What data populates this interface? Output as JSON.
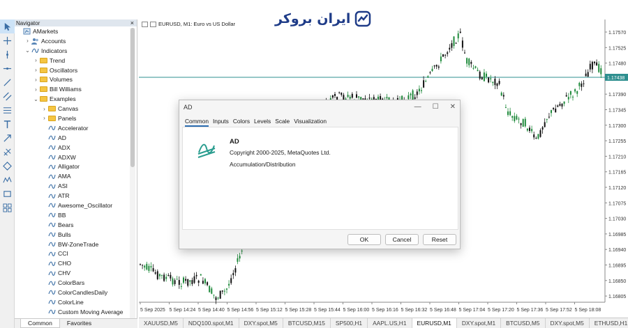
{
  "toolbar": {
    "tools": [
      "cursor-icon",
      "crosshair-icon",
      "vertical-line-icon",
      "horizontal-line-icon",
      "trendline-icon",
      "channel-icon",
      "fibonacci-icon",
      "text-icon",
      "arrow-icon",
      "pitchfork-icon",
      "shape-icon",
      "elliott-icon",
      "rectangle-icon",
      "objects-icon"
    ]
  },
  "navigator": {
    "title": "Navigator",
    "close": "×",
    "tree": [
      {
        "label": "AMarkets",
        "level": 0,
        "chev": "",
        "icon": "broker"
      },
      {
        "label": "Accounts",
        "level": 1,
        "chev": "›",
        "icon": "accounts"
      },
      {
        "label": "Indicators",
        "level": 1,
        "chev": "⌄",
        "icon": "indicator"
      },
      {
        "label": "Trend",
        "level": 2,
        "chev": "›",
        "icon": "folder"
      },
      {
        "label": "Oscillators",
        "level": 2,
        "chev": "›",
        "icon": "folder"
      },
      {
        "label": "Volumes",
        "level": 2,
        "chev": "›",
        "icon": "folder"
      },
      {
        "label": "Bill Williams",
        "level": 2,
        "chev": "›",
        "icon": "folder"
      },
      {
        "label": "Examples",
        "level": 2,
        "chev": "⌄",
        "icon": "folder"
      },
      {
        "label": "Canvas",
        "level": 3,
        "chev": "›",
        "icon": "folder"
      },
      {
        "label": "Panels",
        "level": 3,
        "chev": "›",
        "icon": "folder"
      },
      {
        "label": "Accelerator",
        "level": 3,
        "chev": "",
        "icon": "indicator"
      },
      {
        "label": "AD",
        "level": 3,
        "chev": "",
        "icon": "indicator"
      },
      {
        "label": "ADX",
        "level": 3,
        "chev": "",
        "icon": "indicator"
      },
      {
        "label": "ADXW",
        "level": 3,
        "chev": "",
        "icon": "indicator"
      },
      {
        "label": "Alligator",
        "level": 3,
        "chev": "",
        "icon": "indicator"
      },
      {
        "label": "AMA",
        "level": 3,
        "chev": "",
        "icon": "indicator"
      },
      {
        "label": "ASI",
        "level": 3,
        "chev": "",
        "icon": "indicator"
      },
      {
        "label": "ATR",
        "level": 3,
        "chev": "",
        "icon": "indicator"
      },
      {
        "label": "Awesome_Oscillator",
        "level": 3,
        "chev": "",
        "icon": "indicator"
      },
      {
        "label": "BB",
        "level": 3,
        "chev": "",
        "icon": "indicator"
      },
      {
        "label": "Bears",
        "level": 3,
        "chev": "",
        "icon": "indicator"
      },
      {
        "label": "Bulls",
        "level": 3,
        "chev": "",
        "icon": "indicator"
      },
      {
        "label": "BW-ZoneTrade",
        "level": 3,
        "chev": "",
        "icon": "indicator"
      },
      {
        "label": "CCI",
        "level": 3,
        "chev": "",
        "icon": "indicator"
      },
      {
        "label": "CHO",
        "level": 3,
        "chev": "",
        "icon": "indicator"
      },
      {
        "label": "CHV",
        "level": 3,
        "chev": "",
        "icon": "indicator"
      },
      {
        "label": "ColorBars",
        "level": 3,
        "chev": "",
        "icon": "indicator"
      },
      {
        "label": "ColorCandlesDaily",
        "level": 3,
        "chev": "",
        "icon": "indicator"
      },
      {
        "label": "ColorLine",
        "level": 3,
        "chev": "",
        "icon": "indicator"
      },
      {
        "label": "Custom Moving Average",
        "level": 3,
        "chev": "",
        "icon": "indicator"
      }
    ],
    "tabs": {
      "common": "Common",
      "favorites": "Favorites"
    }
  },
  "logo": {
    "text": "ایران بروکر"
  },
  "chart": {
    "title": "EURUSD, M1:  Euro vs US Dollar",
    "bid_line_value": "1.17438",
    "price_ticks": [
      "1.17570",
      "1.17525",
      "1.17480",
      "1.17438",
      "1.17390",
      "1.17345",
      "1.17300",
      "1.17255",
      "1.17210",
      "1.17165",
      "1.17120",
      "1.17075",
      "1.17030",
      "1.16985",
      "1.16940",
      "1.16895",
      "1.16850",
      "1.16805"
    ],
    "time_ticks": [
      "5 Sep 2025",
      "5 Sep 14:24",
      "5 Sep 14:40",
      "5 Sep 14:56",
      "5 Sep 15:12",
      "5 Sep 15:28",
      "5 Sep 15:44",
      "5 Sep 16:00",
      "5 Sep 16:16",
      "5 Sep 16:32",
      "5 Sep 16:48",
      "5 Sep 17:04",
      "5 Sep 17:20",
      "5 Sep 17:36",
      "5 Sep 17:52",
      "5 Sep 18:08"
    ],
    "colors": {
      "bull": "#1f8a3b",
      "bear": "#111111",
      "bid": "#2e8f8f"
    }
  },
  "symbol_tabs": [
    {
      "label": "XAUUSD,M5",
      "active": false
    },
    {
      "label": "NDQ100.spot,M1",
      "active": false
    },
    {
      "label": "DXY.spot,M5",
      "active": false
    },
    {
      "label": "BTCUSD,M15",
      "active": false
    },
    {
      "label": "SP500,H1",
      "active": false
    },
    {
      "label": "AAPL.US,H1",
      "active": false
    },
    {
      "label": "EURUSD,M1",
      "active": true
    },
    {
      "label": "DXY.spot,M1",
      "active": false
    },
    {
      "label": "BTCUSD,M5",
      "active": false
    },
    {
      "label": "DXY.spot,M5",
      "active": false
    },
    {
      "label": "ETHUSD,H1",
      "active": false
    }
  ],
  "dialog": {
    "title": "AD",
    "controls": {
      "minimize": "—",
      "maximize": "☐",
      "close": "✕"
    },
    "tabs": [
      "Common",
      "Inputs",
      "Colors",
      "Levels",
      "Scale",
      "Visualization"
    ],
    "name": "AD",
    "copyright": "Copyright 2000-2025, MetaQuotes Ltd.",
    "description": "Accumulation/Distribution",
    "buttons": {
      "ok": "OK",
      "cancel": "Cancel",
      "reset": "Reset"
    }
  }
}
